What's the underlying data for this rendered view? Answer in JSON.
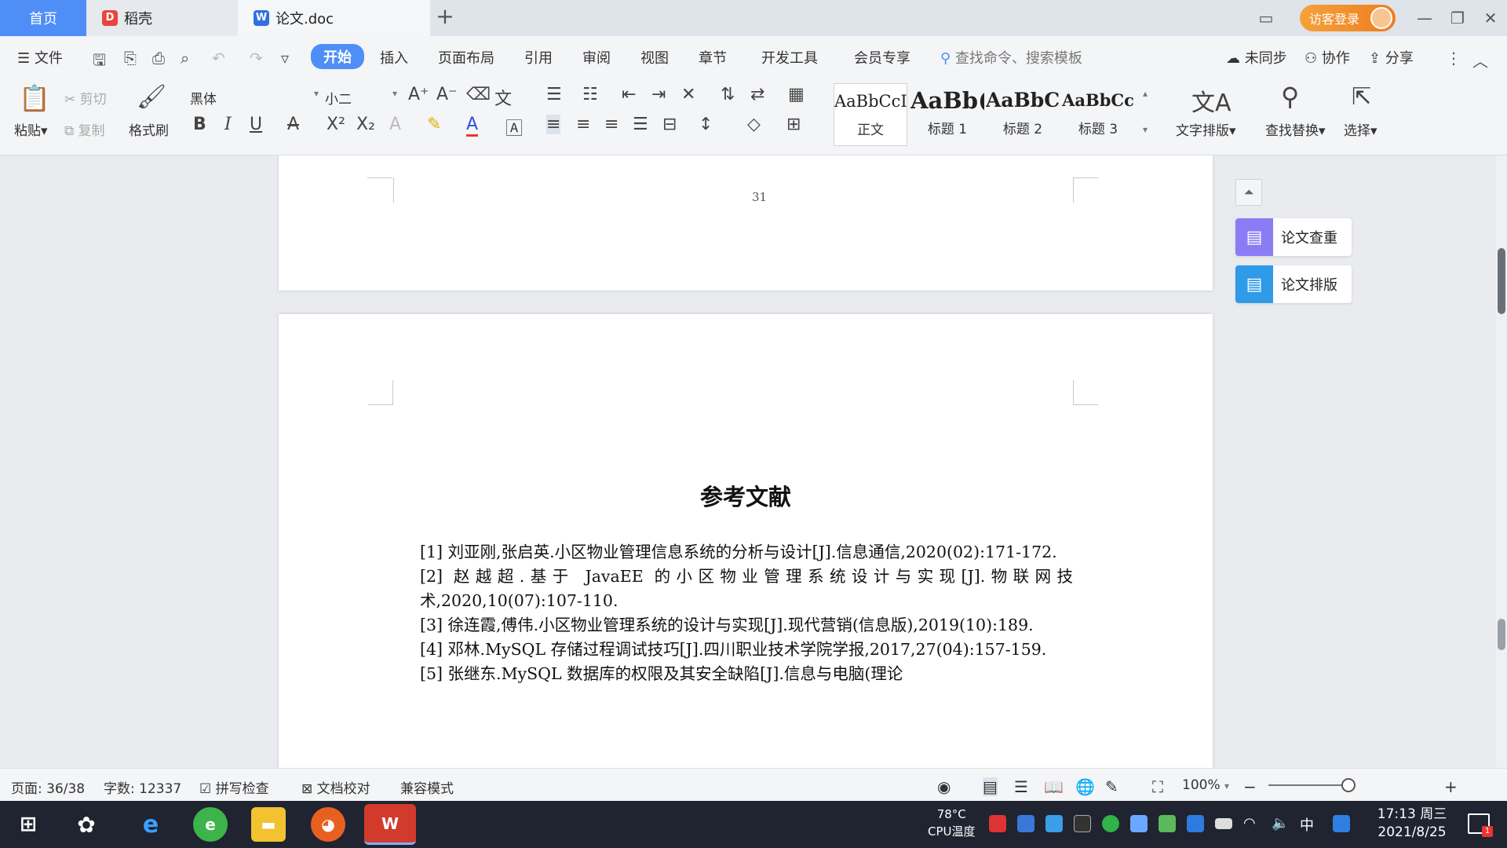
{
  "titlebar": {
    "tabs": [
      {
        "label": "首页"
      },
      {
        "label": "稻壳"
      },
      {
        "label": "论文.doc"
      }
    ],
    "login_label": "访客登录"
  },
  "menubar": {
    "file_label": "文件",
    "items": [
      "开始",
      "插入",
      "页面布局",
      "引用",
      "审阅",
      "视图",
      "章节",
      "开发工具",
      "会员专享"
    ],
    "search_placeholder": "查找命令、搜索模板",
    "sync_label": "未同步",
    "collab_label": "协作",
    "share_label": "分享"
  },
  "ribbon": {
    "paste": "粘贴",
    "cut": "剪切",
    "copy": "复制",
    "format_painter": "格式刷",
    "font_name": "黑体",
    "font_size": "小二",
    "styles": [
      {
        "preview": "AaBbCcI",
        "label": "正文"
      },
      {
        "preview": "AaBb(",
        "label": "标题 1"
      },
      {
        "preview": "AaBbC",
        "label": "标题 2"
      },
      {
        "preview": "AaBbCc",
        "label": "标题 3"
      }
    ],
    "text_layout": "文字排版",
    "find_replace": "查找替换",
    "select": "选择"
  },
  "document": {
    "prev_page_number": "31",
    "heading": "参考文献",
    "references": [
      "[1] 刘亚刚,张启英.小区物业管理信息系统的分析与设计[J].信息通信,2020(02):171-172.",
      "[2] 赵越超.基于 JavaEE 的小区物业管理系统设计与实现[J].物联网技术,2020,10(07):107-110.",
      "[3] 徐连霞,傅伟.小区物业管理系统的设计与实现[J].现代营销(信息版),2019(10):189.",
      "[4] 邓林.MySQL 存储过程调试技巧[J].四川职业技术学院学报,2017,27(04):157-159.",
      "[5] 张继东.MySQL 数据库的权限及其安全缺陷[J].信息与电脑(理论"
    ]
  },
  "side_panel": {
    "check_label": "论文查重",
    "layout_label": "论文排版"
  },
  "statusbar": {
    "page": "页面: 36/38",
    "word_count": "字数: 12337",
    "spell_check": "拼写检查",
    "doc_proof": "文档校对",
    "compat_mode": "兼容模式",
    "zoom": "100%"
  },
  "taskbar": {
    "cpu_temp": "78°C",
    "cpu_label": "CPU温度",
    "ime": "中",
    "time": "17:13 周三",
    "date": "2021/8/25",
    "notification_count": "1"
  },
  "colors": {
    "accent": "#4f8ef7",
    "login": "#ee7d1f",
    "check_icon": "#8b7cf6",
    "layout_icon": "#2f9be8"
  }
}
